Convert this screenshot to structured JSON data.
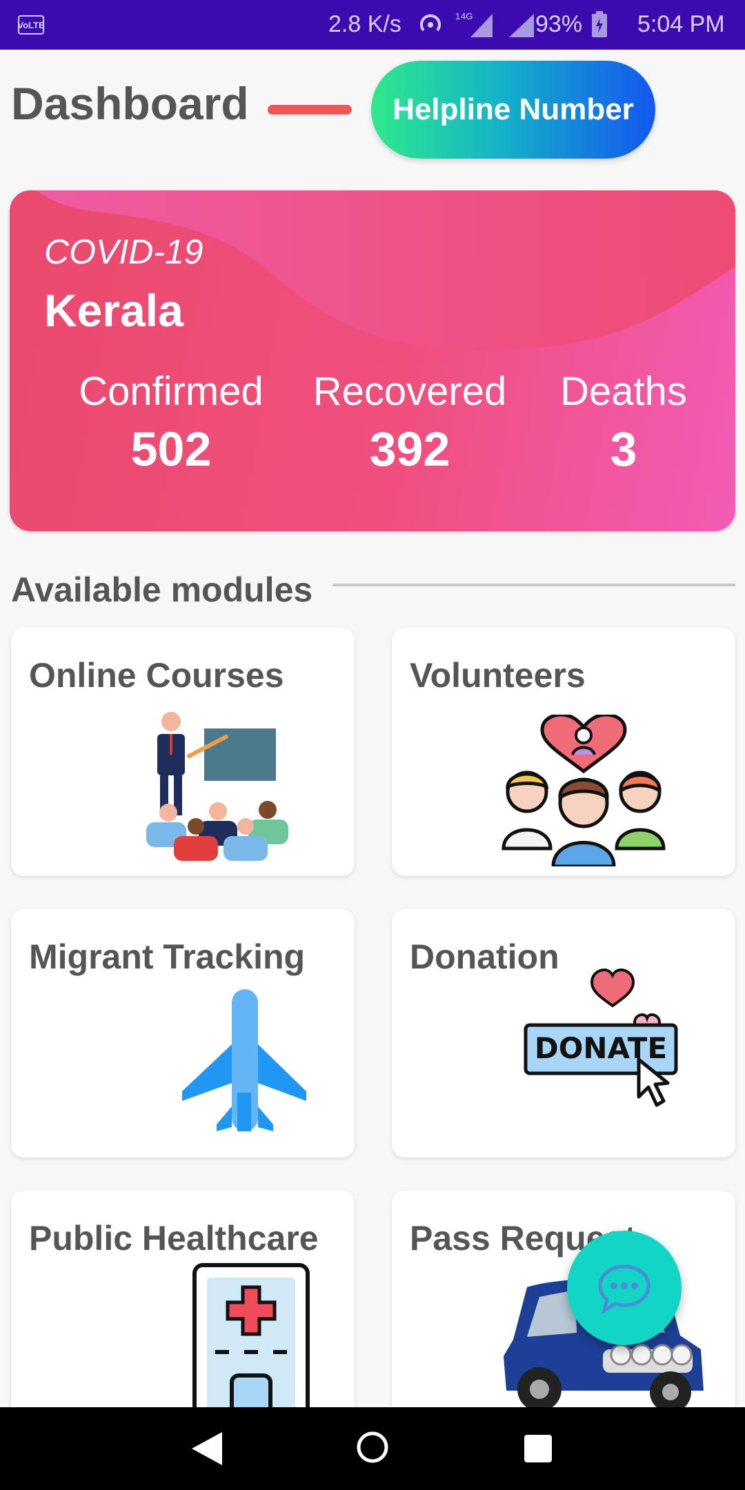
{
  "status_bar": {
    "volte": "VoLTE",
    "speed": "2.8 K/s",
    "network": "4G",
    "battery": "93%",
    "time": "5:04 PM"
  },
  "header": {
    "title": "Dashboard",
    "helpline_label": "Helpline Number"
  },
  "covid_card": {
    "label": "COVID-19",
    "state": "Kerala",
    "stats": [
      {
        "label": "Confirmed",
        "value": "502"
      },
      {
        "label": "Recovered",
        "value": "392"
      },
      {
        "label": "Deaths",
        "value": "3"
      }
    ]
  },
  "modules": {
    "title": "Available modules",
    "items": [
      {
        "label": "Online Courses",
        "icon": "classroom-icon"
      },
      {
        "label": "Volunteers",
        "icon": "volunteers-icon"
      },
      {
        "label": "Migrant Tracking",
        "icon": "airplane-icon"
      },
      {
        "label": "Donation",
        "icon": "donate-icon"
      },
      {
        "label": "Public Healthcare",
        "icon": "hospital-icon"
      },
      {
        "label": "Pass Request",
        "icon": "car-icon"
      }
    ],
    "donate_text": "DONATE"
  },
  "fab": {
    "icon": "chat-bubble-icon"
  },
  "nav": {
    "back": "back-icon",
    "home": "home-icon",
    "recent": "recent-apps-icon"
  },
  "colors": {
    "status_bar": "#3c0bb0",
    "accent_red": "#f25557",
    "card_pink": "#ef4f7d",
    "fab": "#12d5c6"
  }
}
